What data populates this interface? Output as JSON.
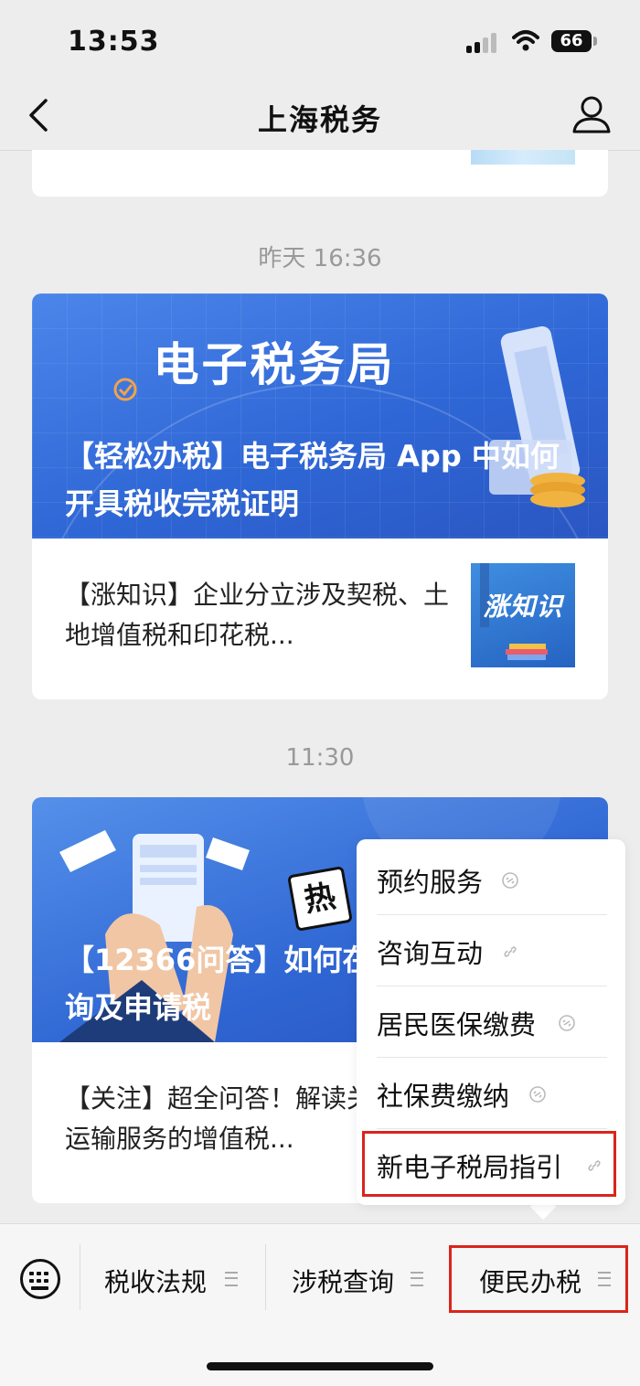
{
  "status_bar": {
    "time": "13:53",
    "battery": "66"
  },
  "nav": {
    "title": "上海税务"
  },
  "groups": [
    {
      "timestamp": "昨天 16:36",
      "hero_heading": "电子税务局",
      "hero_caption": "【轻松办税】电子税务局 App 中如何开具税收完税证明",
      "sub_text": "【涨知识】企业分立涉及契税、土地增值税和印花税...",
      "sub_thumb_text": "涨知识"
    },
    {
      "timestamp": "11:30",
      "hero_caption": "【12366问答】如何在电子税务局中查询及申请税",
      "hot_badge": "热",
      "sub_text": "【关注】超全问答！解读关于旅客运输服务的增值税..."
    }
  ],
  "popup_menu": [
    {
      "label": "预约服务"
    },
    {
      "label": "咨询互动"
    },
    {
      "label": "居民医保缴费"
    },
    {
      "label": "社保费缴纳"
    },
    {
      "label": "新电子税局指引",
      "highlighted": true
    }
  ],
  "bottom_tabs": [
    {
      "label": "税收法规"
    },
    {
      "label": "涉税查询"
    },
    {
      "label": "便民办税",
      "highlighted": true
    }
  ],
  "colors": {
    "accent_blue": "#2f67d6",
    "highlight_red": "#d9251b"
  }
}
